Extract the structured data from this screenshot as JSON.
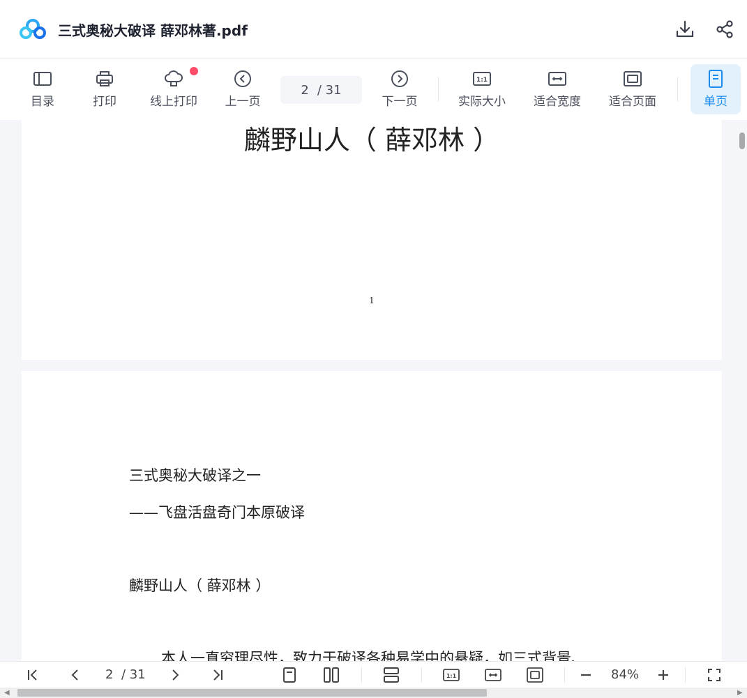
{
  "header": {
    "title": "三式奥秘大破译 薛邓林著.pdf",
    "logo_icon": "baidu-netdisk-cloud-icon",
    "download_icon": "download-icon",
    "share_icon": "share-icon"
  },
  "toolbar": {
    "toc_label": "目录",
    "print_label": "打印",
    "online_print_label": "线上打印",
    "prev_label": "上一页",
    "current_page": "2",
    "total_pages": "/ 31",
    "next_label": "下一页",
    "actual_size_label": "实际大小",
    "fit_width_label": "适合宽度",
    "fit_page_label": "适合页面",
    "single_page_label": "单页",
    "accent_color": "#1a8cf0",
    "badge_color": "#ff4d6b"
  },
  "document": {
    "page1": {
      "title": "麟野山人（  薛邓林  ）",
      "page_number": "1"
    },
    "page2": {
      "line1": "三式奥秘大破译之一",
      "line2": "——飞盘活盘奇门本原破译",
      "line3": "麟野山人（  薛邓林  ）",
      "line4": "本人一直穷理尽性，致力于破译各种易学中的悬疑，如三式背景、"
    }
  },
  "bottombar": {
    "current_page": "2",
    "total_pages": "/ 31",
    "zoom": "84%",
    "first_icon": "first-page-icon",
    "prev_icon": "chevron-left-icon",
    "next_icon": "chevron-right-icon",
    "last_icon": "last-page-icon",
    "single_icon": "single-page-view-icon",
    "double_icon": "double-page-view-icon",
    "scroll_icon": "continuous-scroll-icon",
    "actual_icon": "actual-size-icon",
    "fitwidth_icon": "fit-width-icon",
    "fitpage_icon": "fit-page-icon",
    "zoom_out_icon": "minus-icon",
    "zoom_in_icon": "plus-icon",
    "fullscreen_icon": "fullscreen-icon"
  }
}
